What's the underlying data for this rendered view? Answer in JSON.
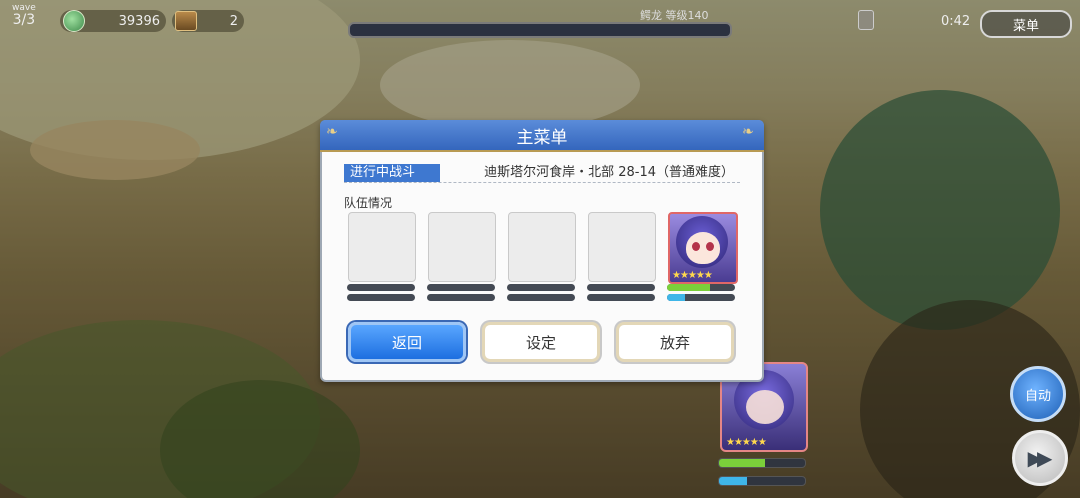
{
  "hud": {
    "wave_label": "wave",
    "wave_value": "3/3",
    "currency": "39396",
    "treasure": "2",
    "boss_name": "鳄龙  等级140",
    "timer": "0:42",
    "menu_label": "菜单",
    "auto_label": "自动"
  },
  "modal": {
    "title": "主菜单",
    "battle_tag": "进行中战斗",
    "battle_location": "迪斯塔尔河食岸・北部 28-14（普通难度）",
    "team_label": "队伍情况",
    "team_slots": [
      {
        "state": "empty"
      },
      {
        "state": "empty"
      },
      {
        "state": "empty"
      },
      {
        "state": "empty"
      },
      {
        "state": "character",
        "stars": "★★★★★",
        "hp_fraction": 0.63,
        "tp_fraction": 0.27
      }
    ],
    "buttons": {
      "back": "返回",
      "settings": "设定",
      "give_up": "放弃"
    }
  },
  "bottom_card": {
    "stars": "★★★★★",
    "hp_fraction": 0.53,
    "tp_fraction": 0.32
  },
  "colors": {
    "header_blue": "#3466bd",
    "primary_button": "#1d6fe0",
    "hp_green": "#7bd03a",
    "tp_blue": "#3fb6e8"
  }
}
